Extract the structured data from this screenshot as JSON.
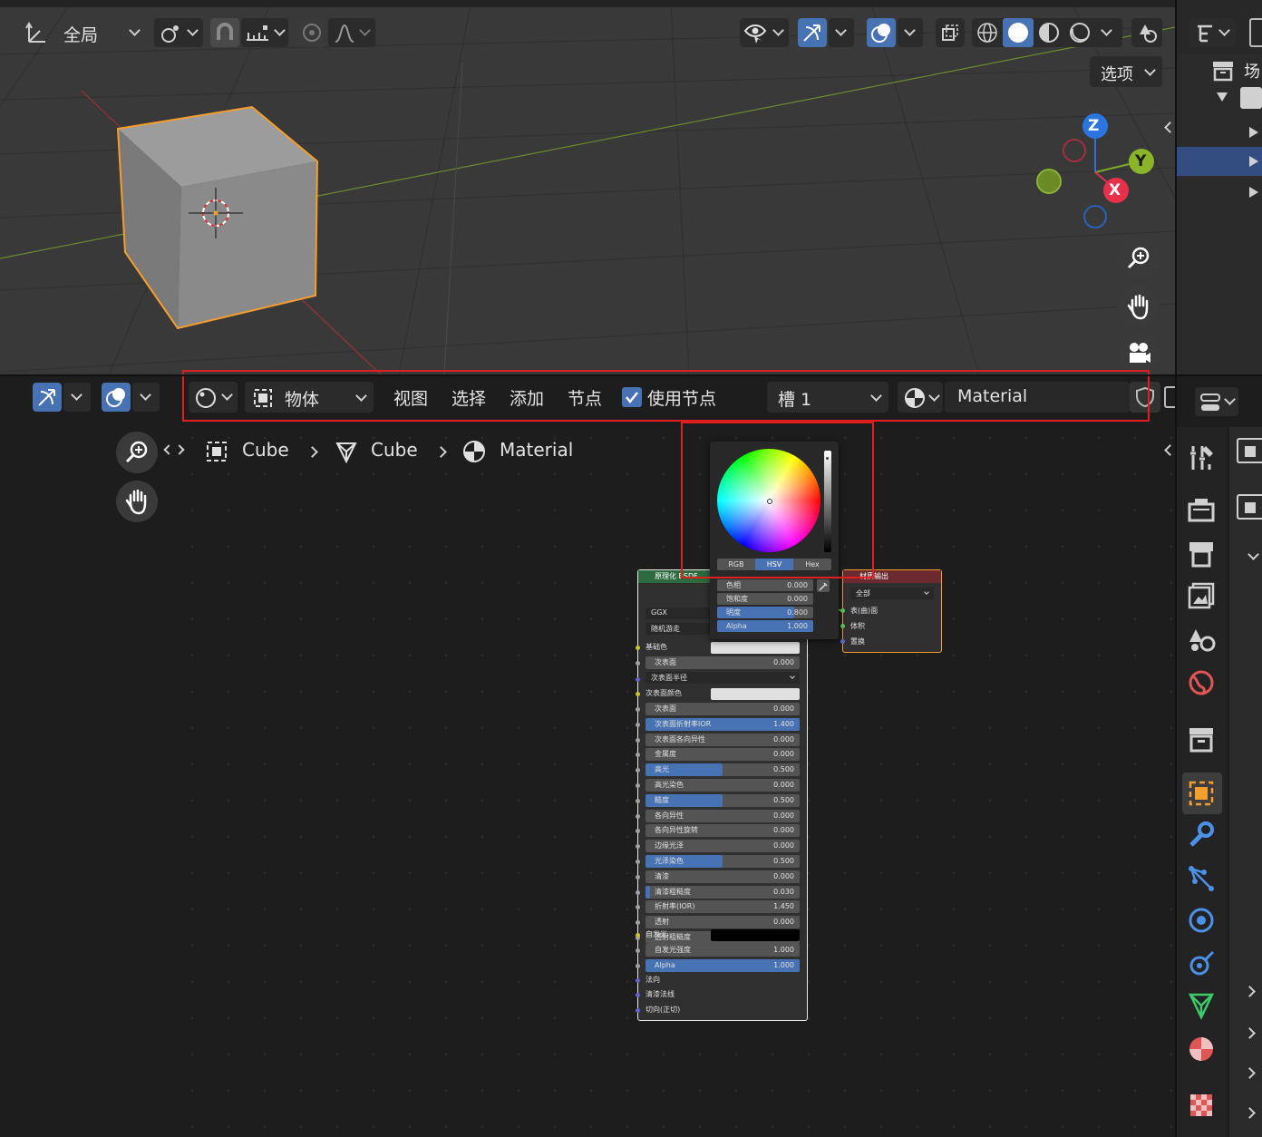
{
  "viewport_header": {
    "transform_orientation": "全局",
    "options_label": "选项"
  },
  "node_editor_header": {
    "object_mode": "物体",
    "menu": [
      "视图",
      "选择",
      "添加",
      "节点"
    ],
    "use_nodes_label": "使用节点",
    "slot": "槽 1",
    "material": "Material"
  },
  "outliner": {
    "scene_label": "场"
  },
  "breadcrumb": {
    "object": "Cube",
    "mesh": "Cube",
    "material": "Material"
  },
  "gizmo": {
    "z": "Z",
    "y": "Y",
    "x": "X"
  },
  "color_picker": {
    "tabs": [
      "RGB",
      "HSV",
      "Hex"
    ],
    "active_tab": "HSV",
    "fields": [
      {
        "label": "色相",
        "value": "0.000",
        "fraction": 0
      },
      {
        "label": "饱和度",
        "value": "0.000",
        "fraction": 0
      },
      {
        "label": "明度",
        "value": "0.800",
        "fraction": 0.8
      },
      {
        "label": "Alpha",
        "value": "1.000",
        "fraction": 1
      }
    ]
  },
  "bsdf_node": {
    "title": "原理化 BSDF",
    "distribution": "GGX",
    "subsurface_method": "随机游走",
    "base_color_label": "基础色",
    "subsurface_radius_label": "次表面半径",
    "subsurface_color_label": "次表面颜色",
    "emission_label": "自发光",
    "normal_label": "法向",
    "clearcoat_normal_label": "清漆法线",
    "tangent_label": "切向(正切)",
    "fields": [
      {
        "label": "次表面",
        "value": "0.000",
        "fraction": 0
      },
      {
        "label": "次表面折射率IOR",
        "value": "1.400",
        "fraction": 1
      },
      {
        "label": "次表面各向异性",
        "value": "0.000",
        "fraction": 0
      },
      {
        "label": "金属度",
        "value": "0.000",
        "fraction": 0
      },
      {
        "label": "高光",
        "value": "0.500",
        "fraction": 0.5
      },
      {
        "label": "高光染色",
        "value": "0.000",
        "fraction": 0
      },
      {
        "label": "糙度",
        "value": "0.500",
        "fraction": 0.5
      },
      {
        "label": "各向异性",
        "value": "0.000",
        "fraction": 0
      },
      {
        "label": "各向异性旋转",
        "value": "0.000",
        "fraction": 0
      },
      {
        "label": "边缘光泽",
        "value": "0.000",
        "fraction": 0
      },
      {
        "label": "光泽染色",
        "value": "0.500",
        "fraction": 0.5
      },
      {
        "label": "清漆",
        "value": "0.000",
        "fraction": 0
      },
      {
        "label": "清漆粗糙度",
        "value": "0.030",
        "fraction": 0.03
      },
      {
        "label": "折射率(IOR)",
        "value": "1.450",
        "fraction": 0
      },
      {
        "label": "透射",
        "value": "0.000",
        "fraction": 0
      },
      {
        "label": "透射粗糙度",
        "value": "0.000",
        "fraction": 0
      }
    ],
    "emission_strength": {
      "label": "自发光强度",
      "value": "1.000",
      "fraction": 0
    },
    "alpha": {
      "label": "Alpha",
      "value": "1.000",
      "fraction": 1
    }
  },
  "output_node": {
    "title": "材质输出",
    "target": "全部",
    "sockets": [
      "表(曲)面",
      "体积",
      "置换"
    ]
  },
  "colors": {
    "accent_blue": "#4772b3",
    "selection_orange": "#f59e2c",
    "highlight_red": "#e02020"
  }
}
